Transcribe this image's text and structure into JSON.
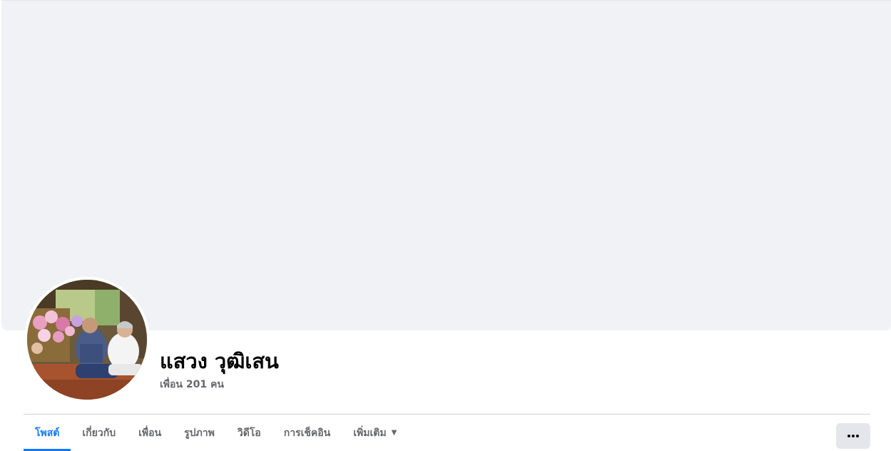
{
  "profile": {
    "name": "แสวง วุฒิเสน",
    "friends": "เพื่อน 201 คน"
  },
  "tabs": [
    {
      "label": "โพสต์",
      "active": true
    },
    {
      "label": "เกี่ยวกับ",
      "active": false
    },
    {
      "label": "เพื่อน",
      "active": false
    },
    {
      "label": "รูปภาพ",
      "active": false
    },
    {
      "label": "วิดีโอ",
      "active": false
    },
    {
      "label": "การเช็คอิน",
      "active": false
    },
    {
      "label": "เพิ่มเติม",
      "active": false,
      "dropdown": true
    }
  ],
  "icons": {
    "more_tab_caret": "caret-down-icon",
    "more_button": "more-horizontal-icon",
    "avatar": "profile-photo"
  },
  "colors": {
    "accent": "#1877f2",
    "cover": "#f0f2f5",
    "muted_text": "#65676b",
    "button_bg": "#e4e6eb"
  }
}
